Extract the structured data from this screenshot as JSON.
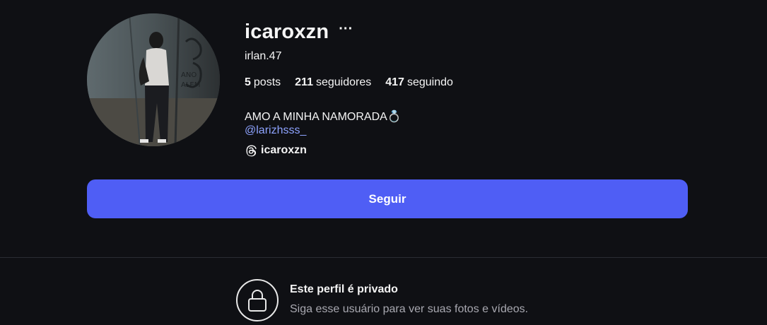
{
  "profile": {
    "username": "icaroxzn",
    "more_label": "···",
    "full_name": "irlan.47",
    "stats": {
      "posts_count": "5",
      "posts_label": "posts",
      "followers_count": "211",
      "followers_label": "seguidores",
      "following_count": "417",
      "following_label": "seguindo"
    },
    "bio": {
      "line1": "AMO A MINHA NAMORADA💍",
      "mention": "@larizhsss_"
    },
    "threads_handle": "icaroxzn"
  },
  "actions": {
    "follow_label": "Seguir"
  },
  "private_notice": {
    "title": "Este perfil é privado",
    "subtitle": "Siga esse usuário para ver suas fotos e vídeos."
  },
  "icons": {
    "more": "ellipsis-icon",
    "threads": "threads-icon",
    "lock": "lock-icon"
  },
  "colors": {
    "background": "#0f1014",
    "follow_button": "#4f5ef5",
    "mention": "#8ea3ff",
    "secondary_text": "#a8a8b0"
  }
}
